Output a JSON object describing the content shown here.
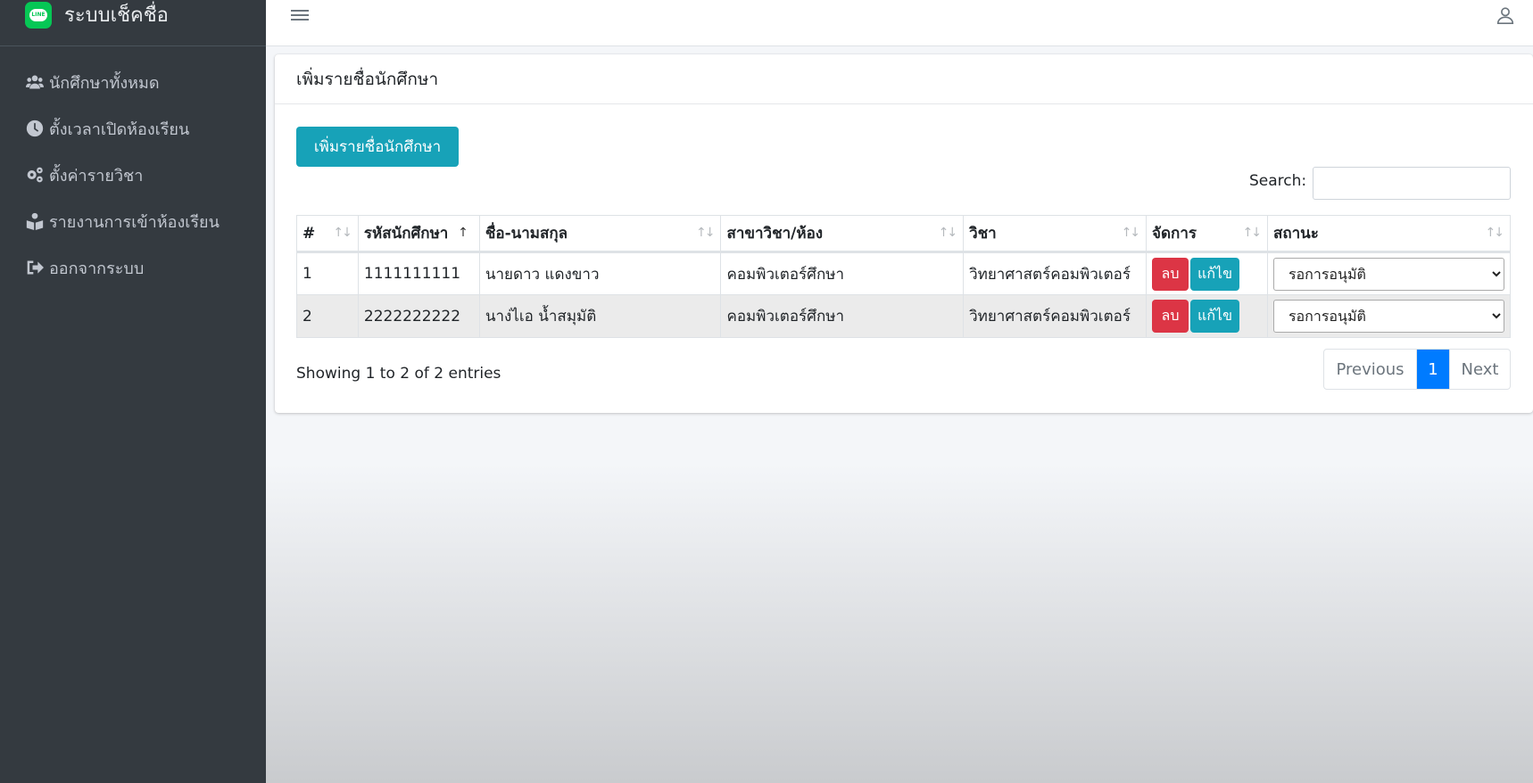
{
  "app": {
    "brand_title": "ระบบเช็คชื่อ",
    "brand_logo_text": "LINE"
  },
  "sidebar": {
    "items": [
      {
        "label": "นักศึกษาทั้งหมด",
        "icon": "users-icon"
      },
      {
        "label": "ตั้งเวลาเปิดห้องเรียน",
        "icon": "clock-icon"
      },
      {
        "label": "ตั้งค่ารายวิชา",
        "icon": "gears-icon"
      },
      {
        "label": "รายงานการเข้าห้องเรียน",
        "icon": "book-reader-icon"
      },
      {
        "label": "ออกจากระบบ",
        "icon": "sign-out-icon"
      }
    ]
  },
  "card": {
    "title": "เพิ่มรายชื่อนักศึกษา",
    "add_button": "เพิ่มรายชื่อนักศึกษา",
    "search_label": "Search:",
    "search_value": ""
  },
  "table": {
    "headers": [
      "#",
      "รหัสนักศึกษา",
      "ชื่อ-นามสกุล",
      "สาขาวิชา/ห้อง",
      "วิชา",
      "จัดการ",
      "สถานะ"
    ],
    "rows": [
      {
        "no": "1",
        "student_id": "1111111111",
        "name": "นายดาว แดงขาว",
        "major": "คอมพิวเตอร์ศึกษา",
        "subject": "วิทยาศาสตร์คอมพิวเตอร์",
        "delete": "ลบ",
        "edit": "แก้ไข",
        "status": "รอการอนุมัติ"
      },
      {
        "no": "2",
        "student_id": "2222222222",
        "name": "นาง่ไเอ น้ำสมุมัติ",
        "major": "คอมพิวเตอร์ศึกษา",
        "subject": "วิทยาศาสตร์คอมพิวเตอร์",
        "delete": "ลบ",
        "edit": "แก้ไข",
        "status": "รอการอนุมัติ"
      }
    ]
  },
  "footer": {
    "info": "Showing 1 to 2 of 2 entries",
    "previous": "Previous",
    "current_page": "1",
    "next": "Next"
  },
  "colors": {
    "sidebar": "#343a40",
    "info": "#17a2b8",
    "danger": "#dc3545",
    "primary": "#007bff"
  }
}
